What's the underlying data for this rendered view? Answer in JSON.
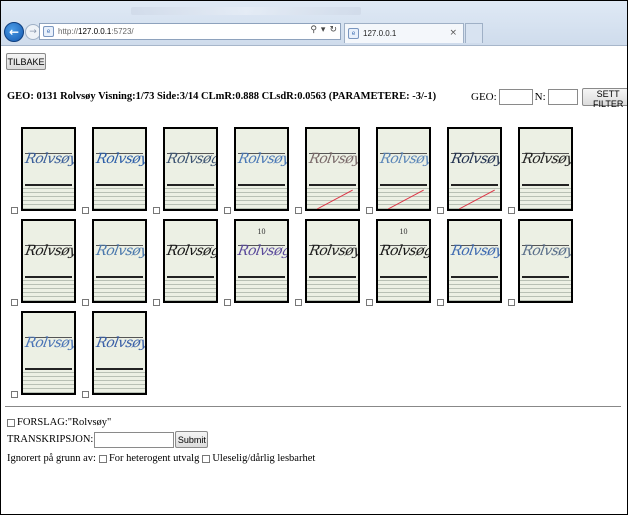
{
  "browser": {
    "url_prefix": "http://",
    "url_host": "127.0.0.1",
    "url_rest": ":5723/",
    "tab_title": "127.0.0.1",
    "tab_close": "×"
  },
  "page": {
    "back_button": "TILBAKE",
    "info_line": "GEO: 0131 Rolvsøy Visning:1/73 Side:3/14 CLmR:0.888 CLsdR:0.0563 (PARAMETERE: -3/-1)",
    "geo_label": "GEO:",
    "geo_value": "",
    "n_label": "N:",
    "n_value": "",
    "filter_button": "SETT FILTER",
    "images": [
      {
        "text": "Rolvsøy",
        "ink": "#3b5f9a",
        "num": ""
      },
      {
        "text": "Rolvsøy",
        "ink": "#2c5ea8",
        "num": ""
      },
      {
        "text": "Rolvsøg",
        "ink": "#3e5573",
        "num": ""
      },
      {
        "text": "Rolvsøy",
        "ink": "#4a78b6",
        "num": ""
      },
      {
        "text": "Rolvsøy",
        "ink": "#7a6a6a",
        "num": ""
      },
      {
        "text": "Rolvsøy",
        "ink": "#5b86b8",
        "num": ""
      },
      {
        "text": "Rolvsøy",
        "ink": "#1f2f4e",
        "num": ""
      },
      {
        "text": "Rolvsøy",
        "ink": "#222222",
        "num": ""
      },
      {
        "text": "Rolvsøy",
        "ink": "#1c1c1c",
        "num": ""
      },
      {
        "text": "Rolvsøy",
        "ink": "#4b79ad",
        "num": ""
      },
      {
        "text": "Rolvsøg",
        "ink": "#1a1a1a",
        "num": ""
      },
      {
        "text": "Rolvsøg",
        "ink": "#5c4c9c",
        "num": "10"
      },
      {
        "text": "Rolvsøy",
        "ink": "#1d1d1d",
        "num": ""
      },
      {
        "text": "Rolvsøg",
        "ink": "#1a1a1a",
        "num": "10"
      },
      {
        "text": "Rolvsøy",
        "ink": "#3e6ab1",
        "num": ""
      },
      {
        "text": "Rolvsøy",
        "ink": "#5a6f8a",
        "num": ""
      },
      {
        "text": "Rolvsøy",
        "ink": "#4a74b6",
        "num": ""
      },
      {
        "text": "Rolvsøy",
        "ink": "#3a60a8",
        "num": ""
      }
    ],
    "suggestion": "FORSLAG:\"Rolvsøy\"",
    "transcription_label": "TRANSKRIPSJON:",
    "transcription_value": "",
    "submit_button": "Submit",
    "ignore_label": "Ignorert på grunn av:",
    "ignore_option_1": "For heterogent utvalg",
    "ignore_option_2": "Uleselig/dårlig lesbarhet"
  }
}
